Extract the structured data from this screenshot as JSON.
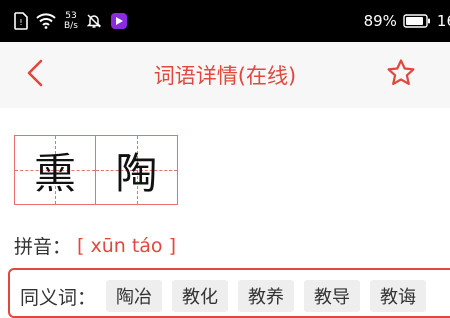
{
  "status_bar": {
    "net_speed_value": "53",
    "net_speed_unit": "B/s",
    "battery_percent": "89%",
    "clock": "16"
  },
  "header": {
    "title": "词语详情(在线)"
  },
  "word": {
    "characters": [
      "熏",
      "陶"
    ],
    "pinyin_label": "拼音：",
    "pinyin_value": "[ xūn táo ]"
  },
  "synonyms": {
    "label": "同义词：",
    "items": [
      "陶冶",
      "教化",
      "教养",
      "教导",
      "教诲"
    ]
  },
  "colors": {
    "accent": "#e0483e",
    "grid_line": "#e87070",
    "title_bar_bg": "#f7f7f7",
    "chip_bg": "#eeeeee"
  },
  "icons": {
    "back": "chevron-left-icon",
    "favorite": "star-outline-icon"
  }
}
